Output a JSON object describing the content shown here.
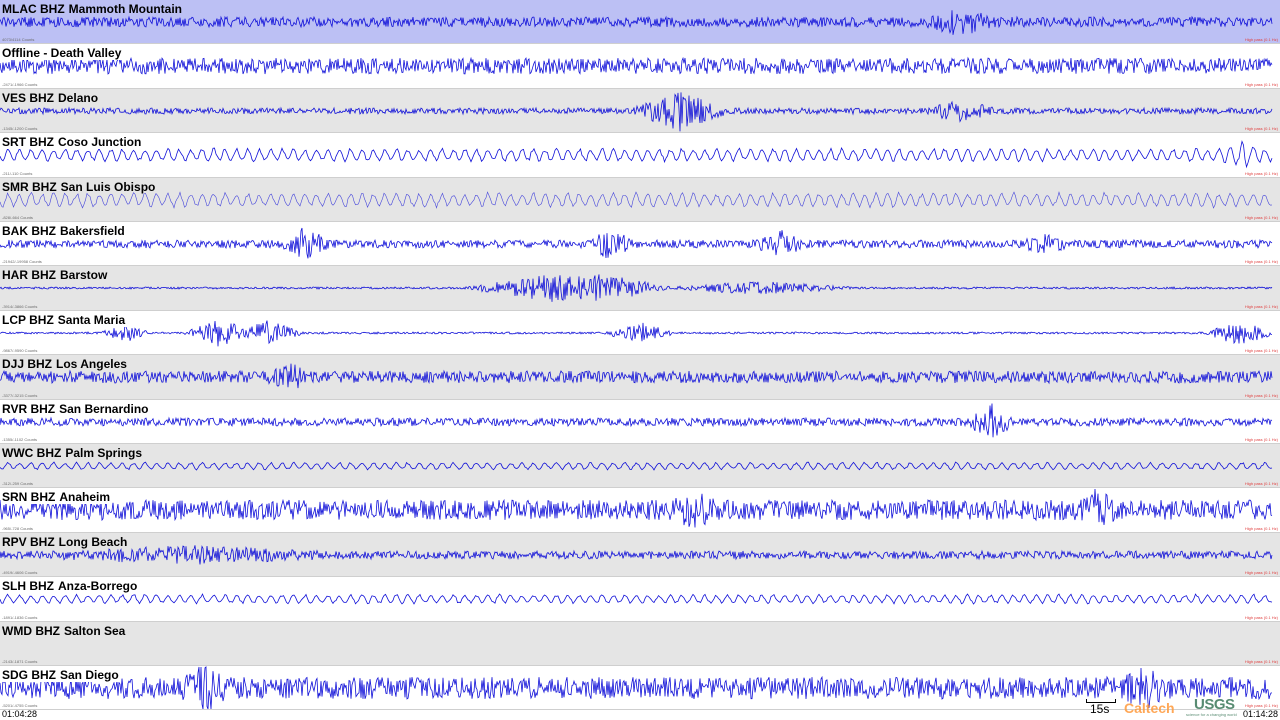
{
  "stations": [
    {
      "code": "MLAC BHZ",
      "name": "Mammoth Mountain",
      "bg": "highlight",
      "amp": 5,
      "bursts": [
        [
          960,
          10,
          3
        ]
      ],
      "style": "dense",
      "counts": "4073/4114 Counts",
      "filter": "High pass (0.1 Hz)"
    },
    {
      "code": "",
      "name": "Offline - Death Valley",
      "bg": "white",
      "amp": 8,
      "bursts": [],
      "style": "dense",
      "counts": "-2471/-1966 Counts",
      "filter": "High pass (0.1 Hz)"
    },
    {
      "code": "VES BHZ",
      "name": "Delano",
      "bg": "gray",
      "amp": 3,
      "bursts": [
        [
          680,
          18,
          4
        ],
        [
          960,
          9,
          3
        ]
      ],
      "style": "dense",
      "counts": "-1345/-1200 Counts",
      "filter": "High pass (0.1 Hz)"
    },
    {
      "code": "SRT BHZ",
      "name": "Coso Junction",
      "bg": "white",
      "amp": 7,
      "bursts": [
        [
          1240,
          8,
          2
        ]
      ],
      "style": "wavy",
      "counts": "-211/-110 Counts",
      "filter": "High pass (0.1 Hz)"
    },
    {
      "code": "SMR BHZ",
      "name": "San Luis Obispo",
      "bg": "gray",
      "amp": 8,
      "bursts": [],
      "style": "light",
      "counts": "-828/-664 Counts",
      "filter": "High pass (0.1 Hz)"
    },
    {
      "code": "BAK BHZ",
      "name": "Bakersfield",
      "bg": "white",
      "amp": 4,
      "bursts": [
        [
          305,
          14,
          2
        ],
        [
          610,
          12,
          2
        ],
        [
          780,
          14,
          2
        ],
        [
          1045,
          8,
          2
        ]
      ],
      "style": "dense",
      "counts": "-21942/-19958 Counts",
      "filter": "High pass (0.1 Hz)"
    },
    {
      "code": "HAR BHZ",
      "name": "Barstow",
      "bg": "gray",
      "amp": 1,
      "bursts": [
        [
          560,
          14,
          8
        ],
        [
          600,
          14,
          6
        ],
        [
          760,
          6,
          8
        ]
      ],
      "style": "dense",
      "counts": "-3914/-3866 Counts",
      "filter": "High pass (0.1 Hz)"
    },
    {
      "code": "LCP BHZ",
      "name": "Santa Maria",
      "bg": "white",
      "amp": 1,
      "bursts": [
        [
          125,
          10,
          2
        ],
        [
          220,
          14,
          3
        ],
        [
          268,
          12,
          3
        ],
        [
          640,
          10,
          3
        ],
        [
          1240,
          12,
          3
        ]
      ],
      "style": "dense",
      "counts": "-9867/-9590 Counts",
      "filter": "High pass (0.1 Hz)"
    },
    {
      "code": "DJJ BHZ",
      "name": "Los Angeles",
      "bg": "gray",
      "amp": 6,
      "bursts": [
        [
          290,
          8,
          2
        ]
      ],
      "style": "dense",
      "counts": "-3377/-3215 Counts",
      "filter": "High pass (0.1 Hz)"
    },
    {
      "code": "RVR BHZ",
      "name": "San Bernardino",
      "bg": "white",
      "amp": 4,
      "bursts": [
        [
          990,
          16,
          2
        ]
      ],
      "style": "dense",
      "counts": "-1355/-1102 Counts",
      "filter": "High pass (0.1 Hz)"
    },
    {
      "code": "WWC BHZ",
      "name": "Palm Springs",
      "bg": "gray",
      "amp": 4,
      "bursts": [],
      "style": "wavy",
      "counts": "-312/-259 Counts",
      "filter": "High pass (0.1 Hz)"
    },
    {
      "code": "SRN BHZ",
      "name": "Anaheim",
      "bg": "white",
      "amp": 10,
      "bursts": [
        [
          1095,
          12,
          2
        ],
        [
          695,
          10,
          2
        ]
      ],
      "style": "dense",
      "counts": "-965/-728 Counts",
      "filter": "High pass (0.1 Hz)"
    },
    {
      "code": "RPV BHZ",
      "name": "Long Beach",
      "bg": "gray",
      "amp": 4,
      "bursts": [
        [
          190,
          6,
          12
        ]
      ],
      "style": "dense",
      "counts": "-4919/-4606 Counts",
      "filter": "High pass (0.1 Hz)"
    },
    {
      "code": "SLH BHZ",
      "name": "Anza-Borrego",
      "bg": "white",
      "amp": 5,
      "bursts": [],
      "style": "wavy",
      "counts": "-1891/-1836 Counts",
      "filter": "High pass (0.1 Hz)"
    },
    {
      "code": "WMD BHZ",
      "name": "Salton Sea",
      "bg": "gray",
      "amp": 0,
      "bursts": [],
      "style": "flat",
      "counts": "-2143/-1871 Counts",
      "filter": "High pass (0.1 Hz)"
    },
    {
      "code": "SDG BHZ",
      "name": "San Diego",
      "bg": "white",
      "amp": 11,
      "bursts": [
        [
          205,
          14,
          2
        ],
        [
          1145,
          12,
          2
        ]
      ],
      "style": "dense",
      "counts": "-5201/-4755 Counts",
      "filter": "High pass (0.1 Hz)"
    }
  ],
  "time": {
    "start": "01:04:28",
    "end": "01:14:28"
  },
  "scale_bar": {
    "label": "15s"
  },
  "logos": {
    "caltech": "Caltech",
    "usgs": "USGS",
    "usgs_tag": "science for a changing world"
  },
  "colors": {
    "trace": "#1010d8",
    "highlight_row": "#bcc0f4",
    "gray_row": "#e5e5e5",
    "white_row": "#ffffff"
  }
}
